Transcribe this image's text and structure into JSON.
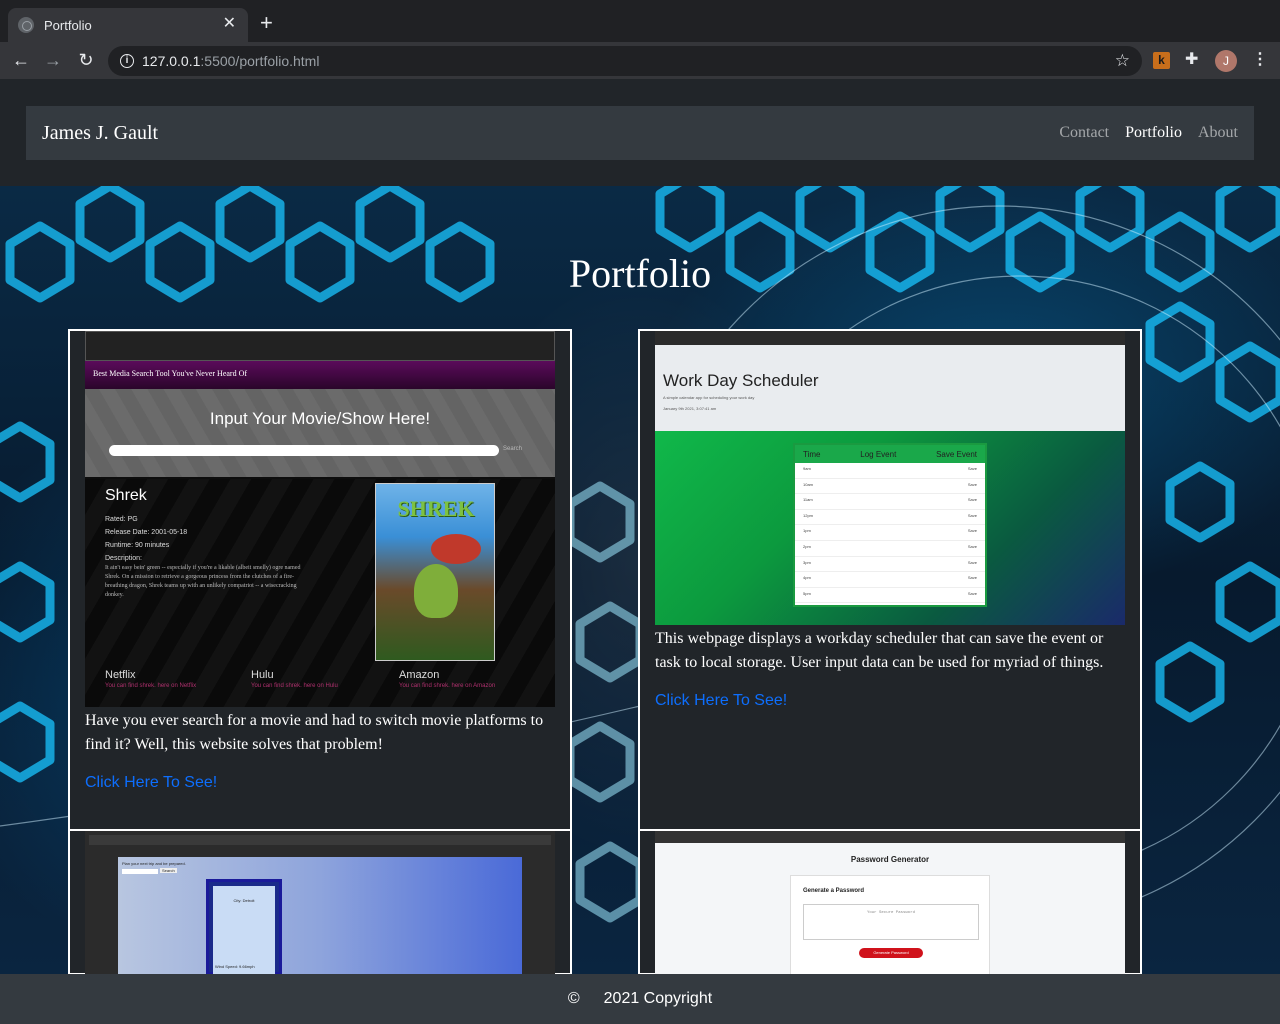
{
  "browser": {
    "tab_title": "Portfolio",
    "close_glyph": "✕",
    "new_tab_glyph": "+",
    "url_host": "127.0.0.1",
    "url_path": ":5500/portfolio.html",
    "extension_letter": "k",
    "profile_initial": "J"
  },
  "navbar": {
    "brand": "James J. Gault",
    "links": [
      "Contact",
      "Portfolio",
      "About"
    ],
    "active": "Portfolio"
  },
  "main": {
    "title": "Portfolio",
    "cards": [
      {
        "description": "Have you ever search for a movie and had to switch movie platforms to find it? Well, this website solves that problem!",
        "link": "Click Here To See!",
        "screenshot": {
          "banner": "Best Media Search Tool You've Never Heard Of",
          "heading": "Input Your Movie/Show Here!",
          "search_button": "Search",
          "result_title": "Shrek",
          "rated": "Rated: PG",
          "release": "Release Date: 2001-05-18",
          "runtime": "Runtime: 90 minutes",
          "description_label": "Description:",
          "blurb": "It ain't easy bein' green -- especially if you're a likable (albeit smelly) ogre named Shrek. On a mission to retrieve a gorgeous princess from the clutches of a fire-breathing dragon, Shrek teams up with an unlikely compatriot -- a wisecracking donkey.",
          "poster_title": "SHREK",
          "services": [
            {
              "name": "Netflix",
              "note": "You can find shrek. here on Netflix"
            },
            {
              "name": "Hulu",
              "note": "You can find shrek. here on Hulu"
            },
            {
              "name": "Amazon",
              "note": "You can find shrek. here on Amazon"
            }
          ]
        }
      },
      {
        "description": "This webpage displays a workday scheduler that can save the event or task to local storage. User input data can be used for myriad of things.",
        "link": "Click Here To See!",
        "screenshot": {
          "heading": "Work Day Scheduler",
          "subtitle": "A simple calendar app for scheduling your work day",
          "date": "January 9th 2021, 3:07:41 am",
          "columns": [
            "Time",
            "Log Event",
            "Save Event"
          ],
          "hours": [
            "9am",
            "10am",
            "11am",
            "12pm",
            "1pm",
            "2pm",
            "3pm",
            "4pm",
            "5pm"
          ],
          "save_label": "Save"
        }
      },
      {
        "screenshot": {
          "prompt": "Plan your next trip and be prepared.",
          "search_button": "Search",
          "city": "City: Detroit",
          "wind": "Wind Speed: 9.66mph"
        }
      },
      {
        "screenshot": {
          "heading": "Password Generator",
          "subheading": "Generate a Password",
          "placeholder": "Your Secure Password",
          "button": "Generate Password"
        }
      }
    ]
  },
  "footer": {
    "copyright_symbol": "©",
    "text": "2021 Copyright"
  },
  "colors": {
    "link": "#0d6efd",
    "navbar": "#343a40",
    "card_bg": "#212529"
  }
}
